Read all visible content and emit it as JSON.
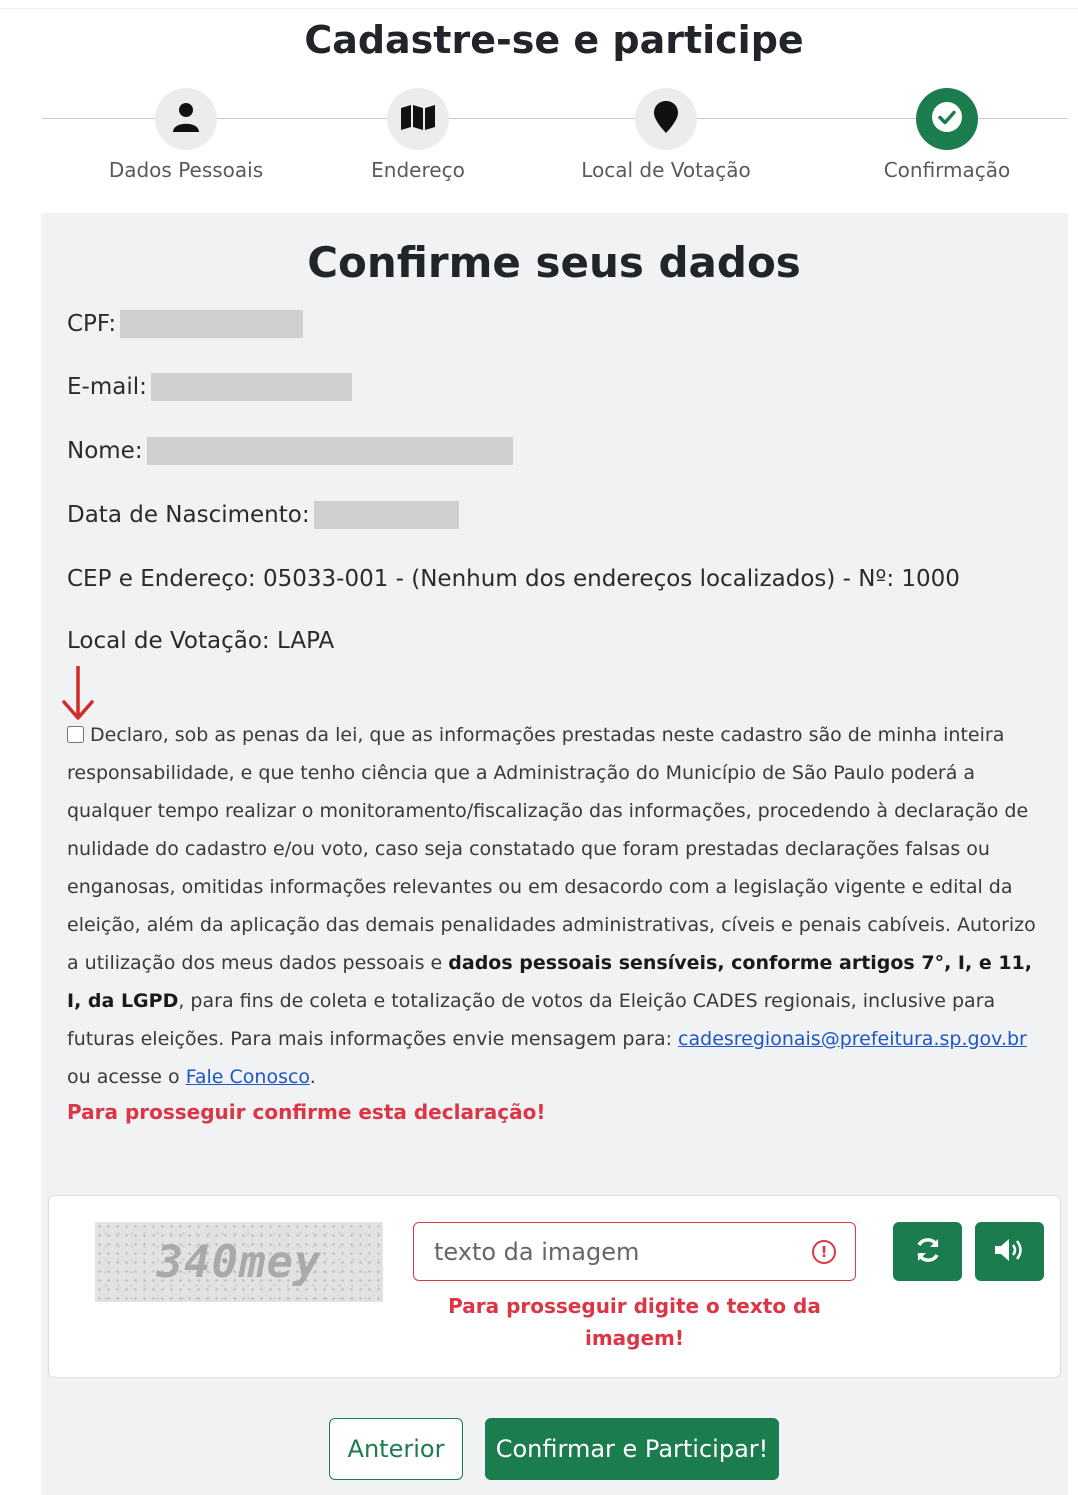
{
  "page_title": "Cadastre-se e participe",
  "steps": [
    {
      "label": "Dados Pessoais",
      "icon": "user-icon",
      "active": false
    },
    {
      "label": "Endereço",
      "icon": "map-icon",
      "active": false
    },
    {
      "label": "Local de Votação",
      "icon": "map-marker-icon",
      "active": false
    },
    {
      "label": "Confirmação",
      "icon": "check-circle-icon",
      "active": true
    }
  ],
  "card_title": "Confirme seus dados",
  "fields": {
    "cpf_label": "CPF:",
    "email_label": "E-mail:",
    "nome_label": "Nome:",
    "nascimento_label": "Data de Nascimento:",
    "endereco_text": "CEP e Endereço: 05033-001 - (Nenhum dos endereços localizados) - Nº: 1000",
    "local_text": "Local de Votação: LAPA"
  },
  "declaration": {
    "text_part1": "Declaro, sob as penas da lei, que as informações prestadas neste cadastro são de minha inteira responsabilidade, e que tenho ciência que a Administração do Município de São Paulo poderá a qualquer tempo realizar o monitoramento/fiscalização das informações, procedendo à declaração de nulidade do cadastro e/ou voto, caso seja constatado que foram prestadas declarações falsas ou enganosas, omitidas informações relevantes ou em desacordo com a legislação vigente e edital da eleição, além da aplicação das demais penalidades administrativas, cíveis e penais cabíveis. Autorizo a utilização dos meus dados pessoais e",
    "bold_text": "dados pessoais sensíveis, conforme artigos 7°, I, e 11, I, da LGPD",
    "text_part2": ", para fins de coleta e totalização de votos da Eleição CADES regionais, inclusive para futuras eleições. Para mais informações envie mensagem para:",
    "email_link": "cadesregionais@prefeitura.sp.gov.br",
    "text_part3": "ou acesse o",
    "contact_link": "Fale Conosco",
    "text_end": ".",
    "warning": "Para prosseguir confirme esta declaração!"
  },
  "captcha": {
    "image_text": "340mey",
    "placeholder": "texto da imagem",
    "error": "Para prosseguir digite o texto da imagem!",
    "refresh_icon": "refresh-icon",
    "audio_icon": "volume-icon"
  },
  "buttons": {
    "previous": "Anterior",
    "confirm": "Confirmar e Participar!"
  },
  "colors": {
    "primary": "#1b7c4e",
    "danger": "#dc3545",
    "link": "#1e56c8",
    "annotation_arrow": "#d62828"
  }
}
